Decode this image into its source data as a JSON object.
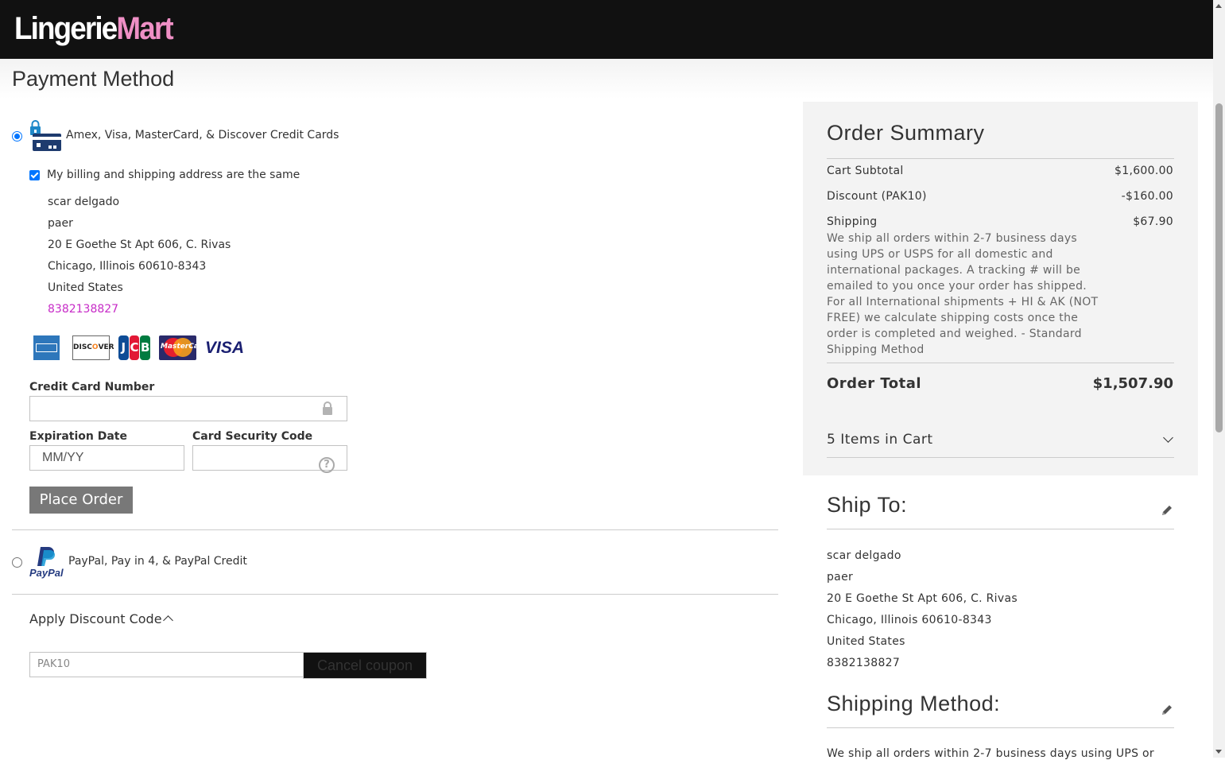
{
  "header": {
    "logo_part1": "Lingerie",
    "logo_part2": "Mart"
  },
  "page_title": "Payment Method",
  "payment": {
    "credit_card_label": "Amex, Visa, MasterCard, & Discover Credit Cards",
    "billing_same_label": "My billing and shipping address are the same",
    "billing_same_checked": true,
    "address": {
      "name": "scar delgado",
      "company": "paer",
      "street": "20 E Goethe St Apt 606, C. Rivas",
      "city_line": "Chicago, Illinois 60610-8343",
      "country": "United States",
      "phone": "8382138827"
    },
    "card_brands": [
      "amex-icon",
      "discover-icon",
      "jcb-icon",
      "mastercard-icon",
      "visa-icon"
    ],
    "card_number_label": "Credit Card Number",
    "card_number_value": "",
    "expiration_label": "Expiration Date",
    "expiration_placeholder": "MM/YY",
    "security_label": "Card Security Code",
    "security_value": "",
    "place_order_label": "Place Order",
    "paypal_label": "PayPal, Pay in 4, & PayPal Credit",
    "paypal_logo_text": "PayPal"
  },
  "discount": {
    "title": "Apply Discount Code",
    "code_value": "PAK10",
    "cancel_label": "Cancel coupon"
  },
  "summary": {
    "title": "Order Summary",
    "subtotal_label": "Cart Subtotal",
    "subtotal_value": "$1,600.00",
    "discount_label": "Discount (PAK10)",
    "discount_value": "-$160.00",
    "shipping_label": "Shipping",
    "shipping_value": "$67.90",
    "shipping_description": "We ship all orders within 2-7 business days using UPS or USPS for all domestic and international packages. A tracking # will be emailed to you once your order has shipped. For all International shipments + HI & AK (NOT FREE) we calculate shipping costs once the order is completed and weighed. - Standard Shipping Method",
    "total_label": "Order Total",
    "total_value": "$1,507.90",
    "items_in_cart": "5 Items in Cart"
  },
  "ship_to": {
    "title": "Ship To:",
    "name": "scar delgado",
    "company": "paer",
    "street": "20 E Goethe St Apt 606, C. Rivas",
    "city_line": "Chicago, Illinois 60610-8343",
    "country": "United States",
    "phone": "8382138827"
  },
  "shipping_method": {
    "title": "Shipping Method:",
    "text": "We ship all orders within 2-7 business days using UPS or"
  },
  "colors": {
    "accent": "#0075ff",
    "phone": "#c72bc7",
    "logo_pink": "#ef8fc5",
    "header_bg": "#111111"
  }
}
